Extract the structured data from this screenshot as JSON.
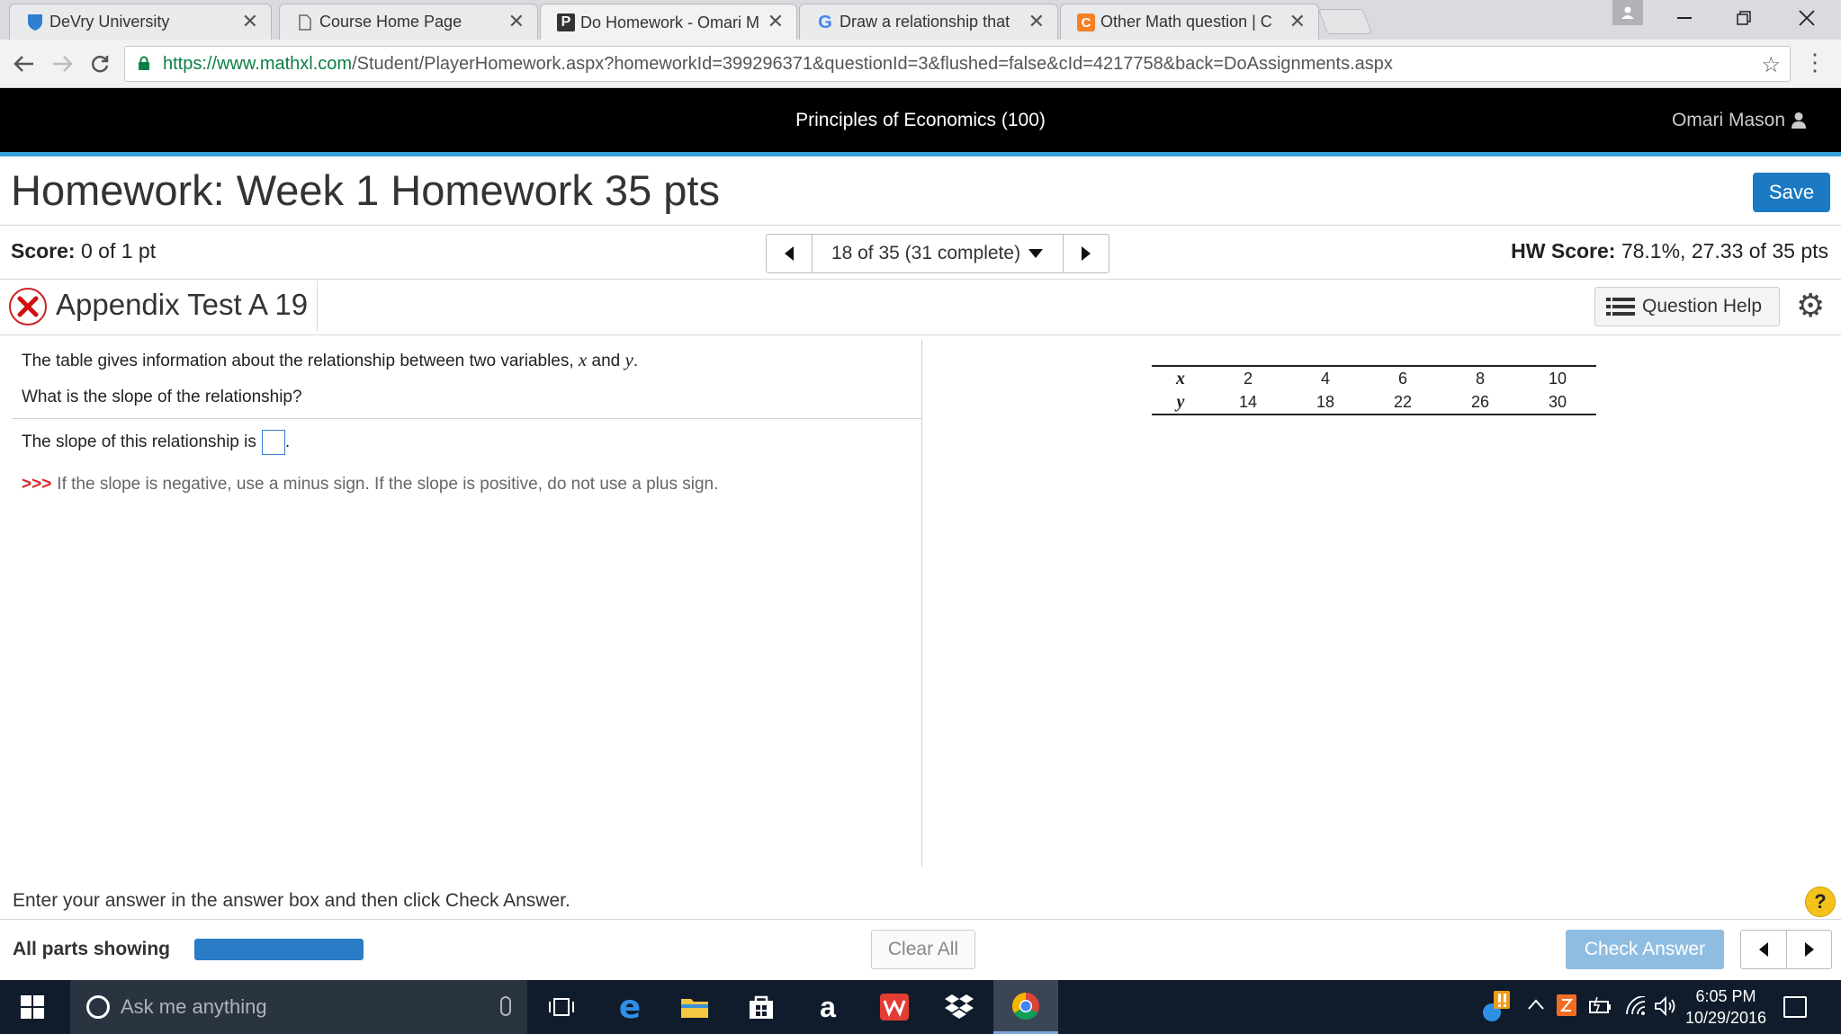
{
  "browser": {
    "tabs": [
      {
        "title": "DeVry University",
        "icon": "devry-shield-icon",
        "active": false
      },
      {
        "title": "Course Home Page",
        "icon": "page-icon",
        "active": false
      },
      {
        "title": "Do Homework - Omari M",
        "icon": "pearson-p-icon",
        "active": true
      },
      {
        "title": "Draw a relationship that",
        "icon": "google-g-icon",
        "active": false
      },
      {
        "title": "Other Math question | C",
        "icon": "chegg-c-icon",
        "active": false
      }
    ],
    "close_glyph": "✕",
    "url_prefix": "https://",
    "url_host": "www.mathxl.com",
    "url_path": "/Student/PlayerHomework.aspx?homeworkId=399296371&questionId=3&flushed=false&cId=4217758&back=DoAssignments.aspx"
  },
  "header": {
    "course": "Principles of Economics (100)",
    "user": "Omari Mason"
  },
  "homework": {
    "title": "Homework: Week 1 Homework 35 pts",
    "save_label": "Save",
    "score_label": "Score:",
    "score_value": "0 of 1 pt",
    "nav_label": "18 of 35 (31 complete)",
    "hw_score_label": "HW Score:",
    "hw_score_value": "78.1%, 27.33 of 35 pts"
  },
  "question": {
    "name": "Appendix Test A 19",
    "status": "incorrect",
    "help_label": "Question Help",
    "intro_pre": "The table gives information about the relationship between two variables,",
    "var_x": "x",
    "and_word": "and",
    "var_y": "y",
    "intro_end": ".",
    "prompt": "What is the slope of the relationship?",
    "answer_pre": "The slope of this relationship is",
    "answer_post": ".",
    "hint_arrows": ">>>",
    "hint": "If the slope is negative, use a minus sign. If the slope is positive, do not use a plus sign.",
    "table": {
      "row_x_label": "x",
      "row_y_label": "y",
      "x": [
        "2",
        "4",
        "6",
        "8",
        "10"
      ],
      "y": [
        "14",
        "18",
        "22",
        "26",
        "30"
      ]
    }
  },
  "footer": {
    "instruction": "Enter your answer in the answer box and then click Check Answer.",
    "parts_label": "All parts showing",
    "progress_fraction": 1.0,
    "clear_label": "Clear All",
    "check_label": "Check Answer",
    "help_glyph": "?"
  },
  "taskbar": {
    "search_placeholder": "Ask me anything",
    "time": "6:05 PM",
    "date": "10/29/2016"
  },
  "colors": {
    "accent_blue": "#1b7ac3",
    "header_stripe": "#36a0d6",
    "error_red": "#d11111",
    "hint_red": "#d9262b"
  }
}
